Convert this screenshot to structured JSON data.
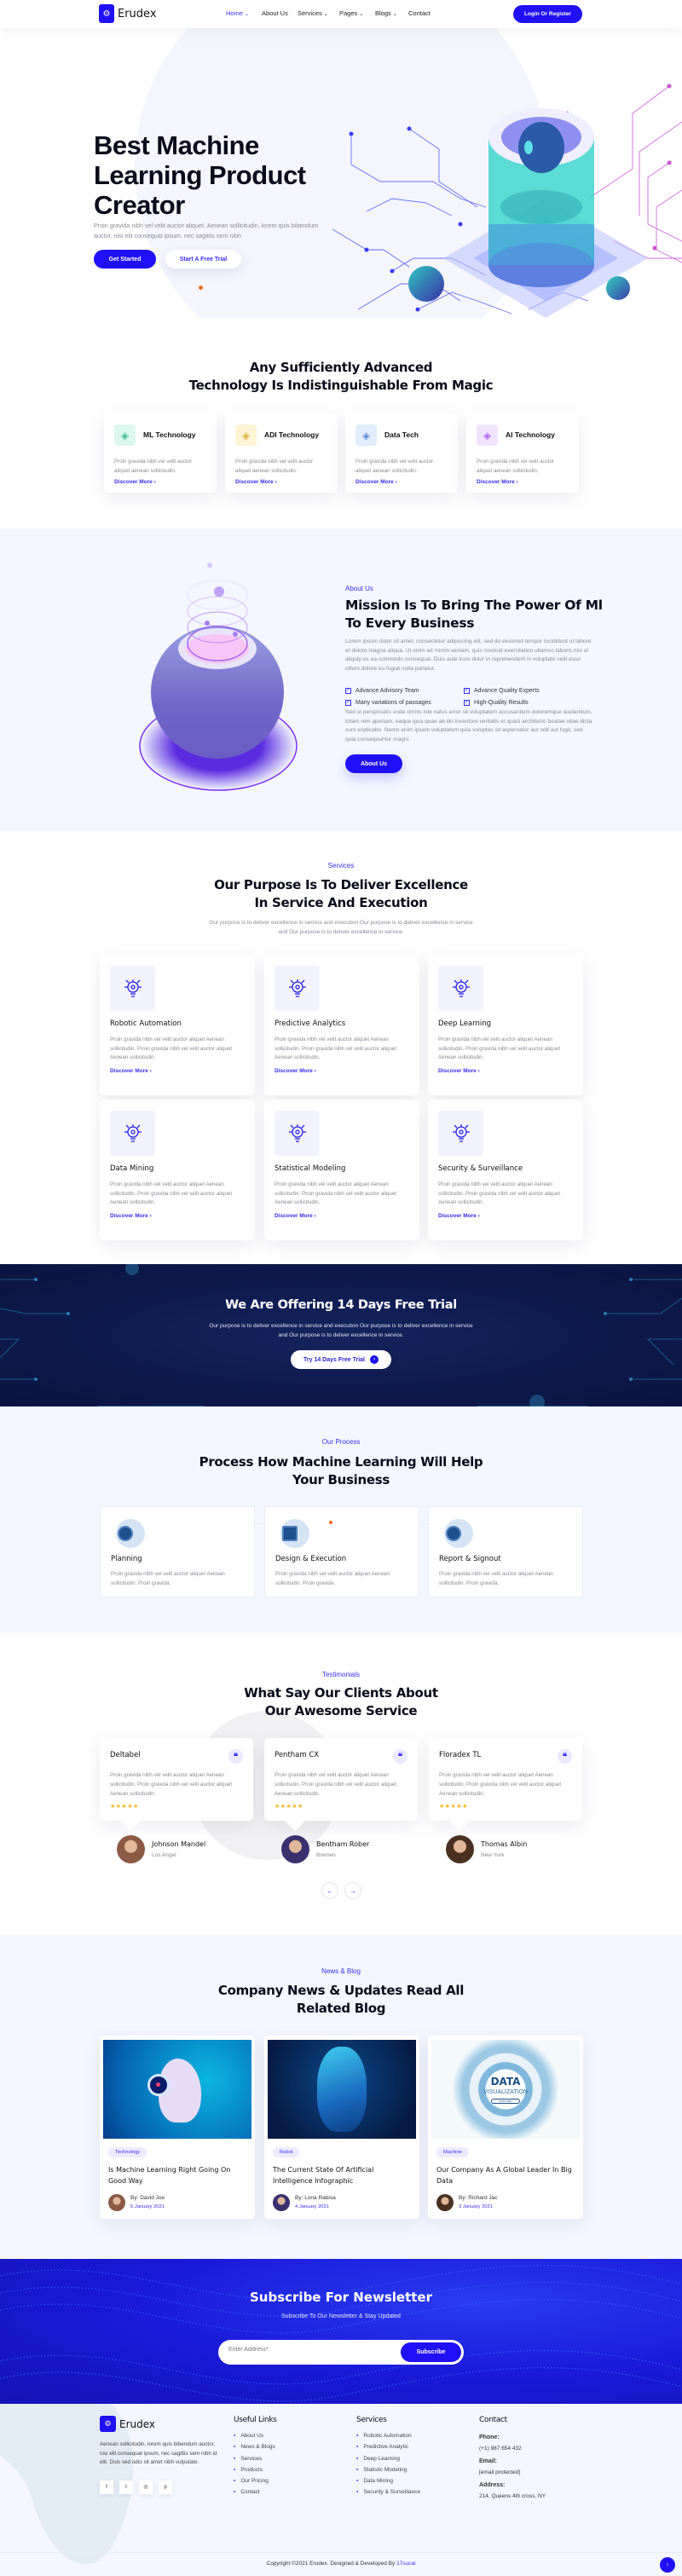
{
  "colors": {
    "primary": "#2010f5",
    "accent": "#3b2cf5",
    "navy": "#0d1a4d",
    "light_bg": "#f4f7ff",
    "star": "#f6b51e",
    "orange": "#f36c21"
  },
  "nav": {
    "logo": "Erudex",
    "links": [
      {
        "label": "Home",
        "active": true,
        "dropdown": true
      },
      {
        "label": "About Us",
        "active": false,
        "dropdown": false
      },
      {
        "label": "Services",
        "active": false,
        "dropdown": true
      },
      {
        "label": "Pages",
        "active": false,
        "dropdown": true
      },
      {
        "label": "Blogs",
        "active": false,
        "dropdown": true
      },
      {
        "label": "Contact",
        "active": false,
        "dropdown": false
      }
    ],
    "login": "Login Or Register"
  },
  "hero": {
    "title_lines": [
      "Best Machine",
      "Learning Product",
      "Creator"
    ],
    "text_lines": [
      "Proin gravida nibh vel velit auctor aliquet. Aenean sollicitudin, lorem quis bibendum",
      "auctor, nisi elit consequat ipsum, nec sagittis sem nibh"
    ],
    "primary": "Get Started",
    "secondary": "Start A Free Trial"
  },
  "features": {
    "title_lines": [
      "Any Sufficiently Advanced",
      "Technology Is Indistinguishable From Magic"
    ],
    "cards": [
      {
        "title": "ML Technology",
        "text_lines": [
          "Proin gravida nibh vel velit auctor",
          "aliquet aenean sollicitudin."
        ],
        "link": "Discover More",
        "icon": "face-scan-icon",
        "bg": "#dcf7ee",
        "fg": "#3fbf96"
      },
      {
        "title": "ADI Technology",
        "text_lines": [
          "Proin gravida nibh vel velit auctor",
          "aliquet aenean sollicitudin."
        ],
        "link": "Discover More",
        "icon": "head-chip-icon",
        "bg": "#fdf4d6",
        "fg": "#e0b43a"
      },
      {
        "title": "Data Tech",
        "text_lines": [
          "Proin gravida nibh vel velit auctor",
          "aliquet aenean sollicitudin."
        ],
        "link": "Discover More",
        "icon": "brain-head-icon",
        "bg": "#e1edfb",
        "fg": "#5d8fd8"
      },
      {
        "title": "AI Technology",
        "text_lines": [
          "Proin gravida nibh vel velit auctor",
          "aliquet aenean sollicitudin."
        ],
        "link": "Discover More",
        "icon": "ai-chip-icon",
        "bg": "#f1e3fd",
        "fg": "#b169ec"
      }
    ]
  },
  "about": {
    "label": "About Us",
    "title_lines": [
      "Mission Is To Bring The Power Of Ml",
      "To Every Business"
    ],
    "para1": "Lorem ipsum dolor sit amet, consectetur adipiscing elit, sed do eiusmod tempor incididunt ut labore et dolore magna aliqua. Ut enim ad minim veniam, quis nostrud exercitation ullamco laboris nisi ut aliquip ex ea commodo consequat. Duis aute irure dolor in reprehenderit in voluptate velit esse cillum dolore eu fugiat nulla pariatur.",
    "checks": [
      "Advance Advisory Team",
      "Advance Quality Experts",
      "Many variations of passages",
      "High-Quality Results"
    ],
    "para2": "Sed ut perspiciatis unde omnis iste natus error sit voluptatem accusantium doloremque laudantium, totam rem aperiam, eaque ipsa quae ab illo inventore veritatis et quasi architecto beatae vitae dicta sunt explicabo. Nemo enim ipsam voluptatem quia voluptas sit aspernatur aut odit aut fugit, sed quia consequuntur magni.",
    "button": "About Us"
  },
  "services": {
    "label": "Services",
    "title_lines": [
      "Our Purpose Is To Deliver Excellence",
      "In Service And Execution"
    ],
    "text_lines": [
      "Our purpose is to deliver excellence in service and execution Our purpose is to deliver excellence in service",
      "and Our purpose is to deliver excellence in service."
    ],
    "cards": [
      {
        "title": "Robotic Automation",
        "icon": "robot-arm-icon",
        "text": "Proin gravida nibh vel velit auctor aliquet Aenean sollicitudin. Proin gravida nibh vel velit auctor aliquet Aenean sollicitudin.",
        "link": "Discover More"
      },
      {
        "title": "Predictive Analytics",
        "icon": "analytics-magnifier-icon",
        "text": "Proin gravida nibh vel velit auctor aliquet Aenean sollicitudin. Proin gravida nibh vel velit auctor aliquet Aenean sollicitudin.",
        "link": "Discover More"
      },
      {
        "title": "Deep Learning",
        "icon": "lightbulb-network-icon",
        "text": "Proin gravida nibh vel velit auctor aliquet Aenean sollicitudin. Proin gravida nibh vel velit auctor aliquet Aenean sollicitudin.",
        "link": "Discover More"
      },
      {
        "title": "Data Mining",
        "icon": "data-mining-icon",
        "text": "Proin gravida nibh vel velit auctor aliquet Aenean sollicitudin. Proin gravida nibh vel velit auctor aliquet Aenean sollicitudin.",
        "link": "Discover More"
      },
      {
        "title": "Statistical Modeling",
        "icon": "network-nodes-icon",
        "text": "Proin gravida nibh vel velit auctor aliquet Aenean sollicitudin. Proin gravida nibh vel velit auctor aliquet Aenean sollicitudin.",
        "link": "Discover More"
      },
      {
        "title": "Security & Surveillance",
        "icon": "security-gear-icon",
        "text": "Proin gravida nibh vel velit auctor aliquet Aenean sollicitudin. Proin gravida nibh vel velit auctor aliquet Aenean sollicitudin.",
        "link": "Discover More"
      }
    ]
  },
  "trial": {
    "title": "We Are Offering 14 Days Free Trial",
    "text_lines": [
      "Our purpose is to deliver excellence in service and execution Our purpose is to deliver excellence in service",
      "and Our purpose is to deliver excellence in service."
    ],
    "button": "Try 14 Days Free Trial"
  },
  "process": {
    "label": "Our Process",
    "title_lines": [
      "Process How Machine Learning Will Help",
      "Your Business"
    ],
    "steps": [
      {
        "title": "Planning",
        "icon": "eye-circuit-icon",
        "text_lines": [
          "Proin gravida nibh vel velit auctor aliquet Aenean",
          "sollicitudin. Proin gravida."
        ]
      },
      {
        "title": "Design & Execution",
        "icon": "cpu-chip-icon",
        "text_lines": [
          "Proin gravida nibh vel velit auctor aliquet Aenean",
          "sollicitudin. Proin gravida."
        ]
      },
      {
        "title": "Report & Signout",
        "icon": "robot-icon",
        "text_lines": [
          "Proin gravida nibh vel velit auctor aliquet Aenean",
          "sollicitudin. Proin gravida."
        ]
      }
    ]
  },
  "testimonials": {
    "label": "Testimonials",
    "title_lines": [
      "What Say Our Clients About",
      "Our Awesome Service"
    ],
    "items": [
      {
        "company": "Deltabel",
        "text": "Proin gravida nibh vel velit auctor aliquet Aenean sollicitudin. Proin gravida nibh vel velit auctor aliquet Aenean sollicitudin.",
        "rating": 5,
        "name": "Johnson Mandel",
        "location": "Los Angel"
      },
      {
        "company": "Pentham CX",
        "text": "Proin gravida nibh vel velit auctor aliquet Aenean sollicitudin. Proin gravida nibh vel velit auctor aliquet Aenean sollicitudin.",
        "rating": 5,
        "name": "Bentham Rober",
        "location": "Bremen"
      },
      {
        "company": "Floradex TL",
        "text": "Proin gravida nibh vel velit auctor aliquet Aenean sollicitudin. Proin gravida nibh vel velit auctor aliquet Aenean sollicitudin.",
        "rating": 5,
        "name": "Thomas Albin",
        "location": "New York"
      }
    ]
  },
  "blog": {
    "label": "News & Blog",
    "title_lines": [
      "Company News & Updates Read All",
      "Related Blog"
    ],
    "posts": [
      {
        "tag": "Technology",
        "title": "Is Machine Learning Right Going On Good Way",
        "author": "By: David Joe",
        "date": "5 January 2021"
      },
      {
        "tag": "Robot",
        "title": "The Current State Of Artificial Intelligence Infographic",
        "author": "By: Lona Rabisa",
        "date": "4 January 2021"
      },
      {
        "tag": "Machine",
        "title": "Our Company As A Global Leader In Big Data",
        "author": "By: Richard Jac",
        "date": "3 January 2021"
      }
    ],
    "image_text": {
      "big": "DATA",
      "small": "VISUALIZATION",
      "tiny": "EXPLORE"
    }
  },
  "newsletter": {
    "title": "Subscribe For Newsletter",
    "subtitle": "Subscribe To Our Newsletter & Stay Updated",
    "placeholder": "Enter Address*",
    "button": "Subscribe"
  },
  "footer": {
    "logo": "Erudex",
    "about": "Aenean sollicitudin, lorem quis bibendum auctor, nisi elit consequat ipsum, nec sagittis sem nibh id elit. Duis sed odio sit amet nibh vulputate.",
    "socials": [
      {
        "icon": "facebook-icon",
        "glyph": "f"
      },
      {
        "icon": "twitter-icon",
        "glyph": "t"
      },
      {
        "icon": "instagram-icon",
        "glyph": "◎"
      },
      {
        "icon": "pinterest-icon",
        "glyph": "p"
      }
    ],
    "useful_title": "Useful Links",
    "useful": [
      "About Us",
      "News & Blogs",
      "Services",
      "Products",
      "Our Pricing",
      "Contact"
    ],
    "services_title": "Services",
    "services": [
      "Robotic Automation",
      "Predictive Analytic",
      "Deep Learning",
      "Statistic Modeling",
      "Data Mining",
      "Security & Surveillance"
    ],
    "contact_title": "Contact",
    "phone_label": "Phone:",
    "phone": "(+1) 987 654 432",
    "email_label": "Email:",
    "email": "[email protected]",
    "address_label": "Address:",
    "address": "214, Queens 4th cross, NY",
    "copyright": "Copyright ©2021 Erudex. Designed & Developed By ",
    "credit": "17sucai"
  }
}
